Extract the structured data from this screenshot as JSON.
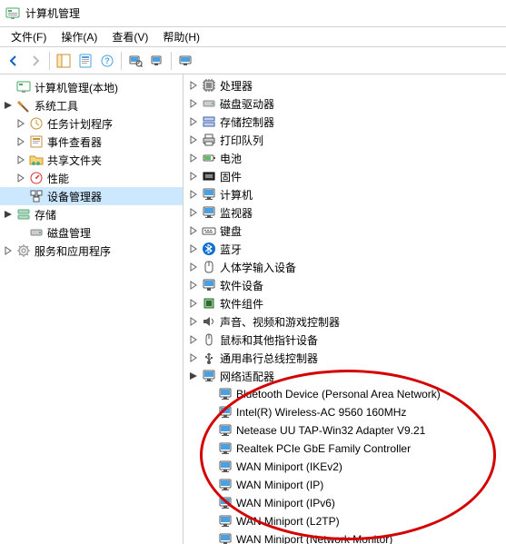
{
  "window": {
    "title": "计算机管理"
  },
  "menu": {
    "file": "文件(F)",
    "action": "操作(A)",
    "view": "查看(V)",
    "help": "帮助(H)"
  },
  "left_tree": {
    "root": "计算机管理(本地)",
    "system_tools": "系统工具",
    "task_scheduler": "任务计划程序",
    "event_viewer": "事件查看器",
    "shared_folders": "共享文件夹",
    "performance": "性能",
    "device_manager": "设备管理器",
    "storage": "存储",
    "disk_management": "磁盘管理",
    "services_apps": "服务和应用程序"
  },
  "right_tree": {
    "processors": "处理器",
    "disk_drives": "磁盘驱动器",
    "storage_controllers": "存储控制器",
    "print_queues": "打印队列",
    "batteries": "电池",
    "firmware": "固件",
    "computer": "计算机",
    "monitors": "监视器",
    "keyboards": "键盘",
    "bluetooth": "蓝牙",
    "hid": "人体学输入设备",
    "software_devices": "软件设备",
    "software_components": "软件组件",
    "sound": "声音、视频和游戏控制器",
    "mice": "鼠标和其他指针设备",
    "usb": "通用串行总线控制器",
    "network_adapters": "网络适配器",
    "adapters": [
      "Bluetooth Device (Personal Area Network)",
      "Intel(R) Wireless-AC 9560 160MHz",
      "Netease UU TAP-Win32 Adapter V9.21",
      "Realtek PCIe GbE Family Controller",
      "WAN Miniport (IKEv2)",
      "WAN Miniport (IP)",
      "WAN Miniport (IPv6)",
      "WAN Miniport (L2TP)",
      "WAN Miniport (Network Monitor)"
    ]
  }
}
